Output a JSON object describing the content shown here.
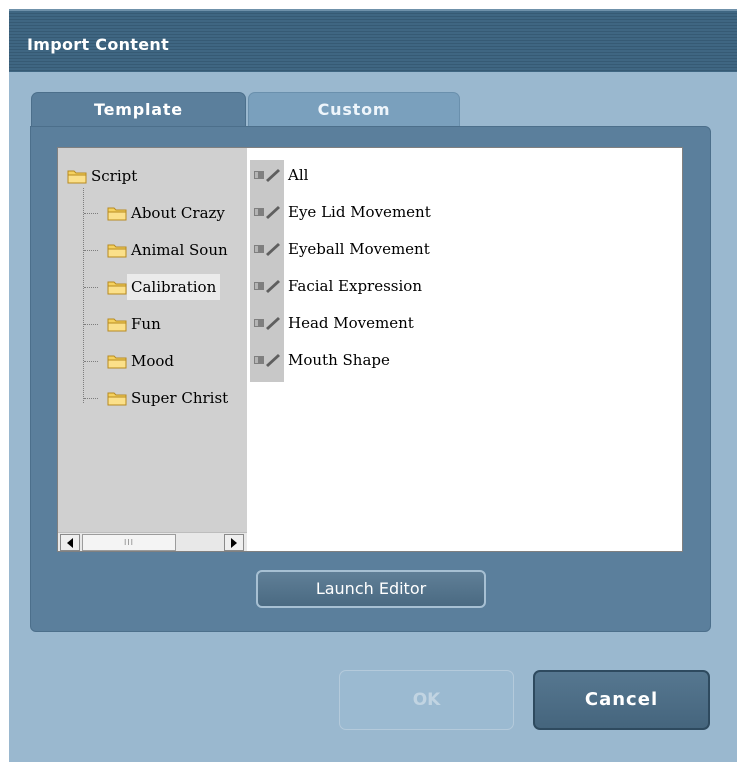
{
  "window": {
    "title": "Import Content"
  },
  "tabs": [
    {
      "label": "Template",
      "active": true
    },
    {
      "label": "Custom",
      "active": false
    }
  ],
  "tree": {
    "root": "Script",
    "children": [
      "About Crazy",
      "Animal Soun",
      "Calibration",
      "Fun",
      "Mood",
      "Super Christ"
    ],
    "selected": "Calibration"
  },
  "list": {
    "items": [
      "All",
      "Eye Lid Movement",
      "Eyeball Movement",
      "Facial Expression",
      "Head Movement",
      "Mouth Shape"
    ]
  },
  "scrollbar": {
    "thumb_grip": "III"
  },
  "buttons": {
    "launch": "Launch Editor",
    "ok": "OK",
    "cancel": "Cancel"
  },
  "colors": {
    "dialog_bg": "#9ab8cf",
    "titlebar": "#3f6682",
    "panel": "#5b7f9c",
    "tab_inactive": "#7aa0bd"
  }
}
